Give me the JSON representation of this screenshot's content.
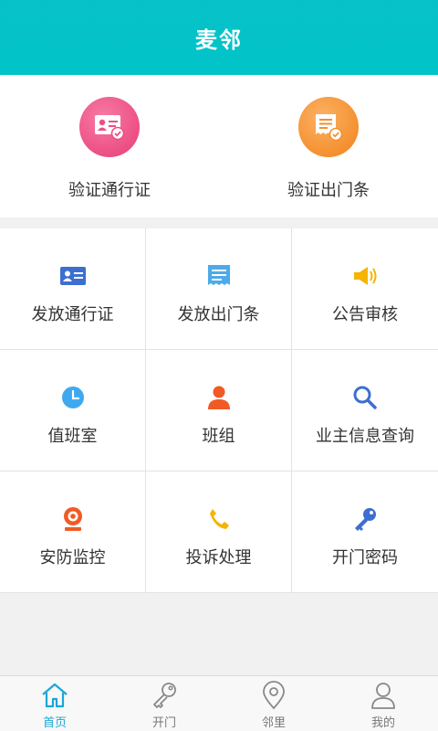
{
  "header": {
    "title": "麦邻"
  },
  "top_actions": [
    {
      "label": "验证通行证",
      "icon": "id-card-check-icon"
    },
    {
      "label": "验证出门条",
      "icon": "receipt-check-icon"
    }
  ],
  "grid_items": [
    {
      "label": "发放通行证",
      "icon": "id-card-icon"
    },
    {
      "label": "发放出门条",
      "icon": "receipt-icon"
    },
    {
      "label": "公告审核",
      "icon": "megaphone-icon"
    },
    {
      "label": "值班室",
      "icon": "clock-icon"
    },
    {
      "label": "班组",
      "icon": "person-icon"
    },
    {
      "label": "业主信息查询",
      "icon": "search-icon"
    },
    {
      "label": "安防监控",
      "icon": "webcam-icon"
    },
    {
      "label": "投诉处理",
      "icon": "phone-icon"
    },
    {
      "label": "开门密码",
      "icon": "key-icon"
    }
  ],
  "tabbar": [
    {
      "label": "首页",
      "icon": "home-icon",
      "active": true
    },
    {
      "label": "开门",
      "icon": "key-outline-icon",
      "active": false
    },
    {
      "label": "邻里",
      "icon": "map-pin-icon",
      "active": false
    },
    {
      "label": "我的",
      "icon": "user-icon",
      "active": false
    }
  ],
  "colors": {
    "header": "#00c4c8",
    "accent_tab": "#1ba6d6",
    "pink": "#ec4f85",
    "orange": "#f5902f"
  }
}
